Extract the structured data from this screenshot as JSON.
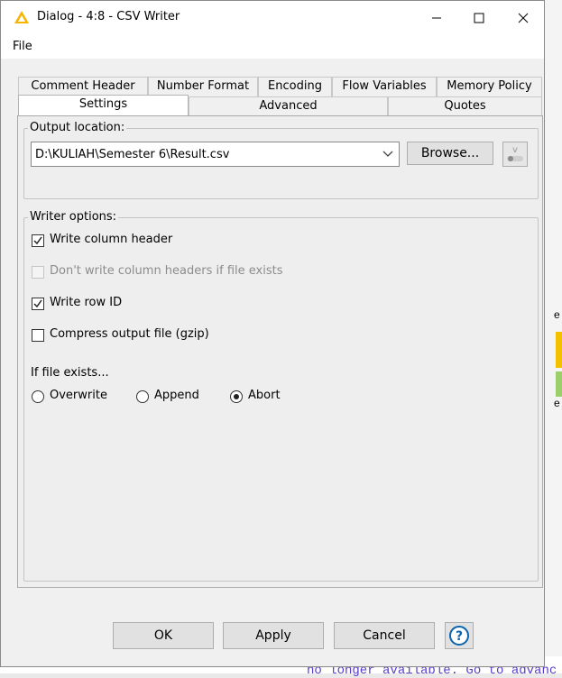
{
  "window": {
    "title": "Dialog - 4:8 - CSV Writer",
    "menu": [
      "File"
    ]
  },
  "tabs": {
    "row_top": [
      "Comment Header",
      "Number Format",
      "Encoding",
      "Flow Variables",
      "Memory Policy"
    ],
    "row_bottom": [
      "Settings",
      "Advanced",
      "Quotes"
    ],
    "active": "Settings"
  },
  "output_location": {
    "group_label": "Output location:",
    "path_value": "D:\\KULIAH\\Semester 6\\Result.csv",
    "browse_label": "Browse..."
  },
  "writer_options": {
    "group_label": "Writer options:",
    "checkboxes": [
      {
        "label": "Write column header",
        "checked": true,
        "enabled": true
      },
      {
        "label": "Don't write column headers if file exists",
        "checked": false,
        "enabled": false
      },
      {
        "label": "Write row ID",
        "checked": true,
        "enabled": true
      },
      {
        "label": "Compress output file (gzip)",
        "checked": false,
        "enabled": true
      }
    ],
    "if_exists_label": "If file exists...",
    "radios": [
      {
        "label": "Overwrite",
        "selected": false
      },
      {
        "label": "Append",
        "selected": false
      },
      {
        "label": "Abort",
        "selected": true
      }
    ]
  },
  "buttons": {
    "ok": "OK",
    "apply": "Apply",
    "cancel": "Cancel",
    "help_icon": "?"
  },
  "background": {
    "fragment_text": "no longer available. Go to advanc",
    "letter_right": "e"
  },
  "colors": {
    "accent": "#0a64ad",
    "warning_triangle": "#f4b400"
  }
}
